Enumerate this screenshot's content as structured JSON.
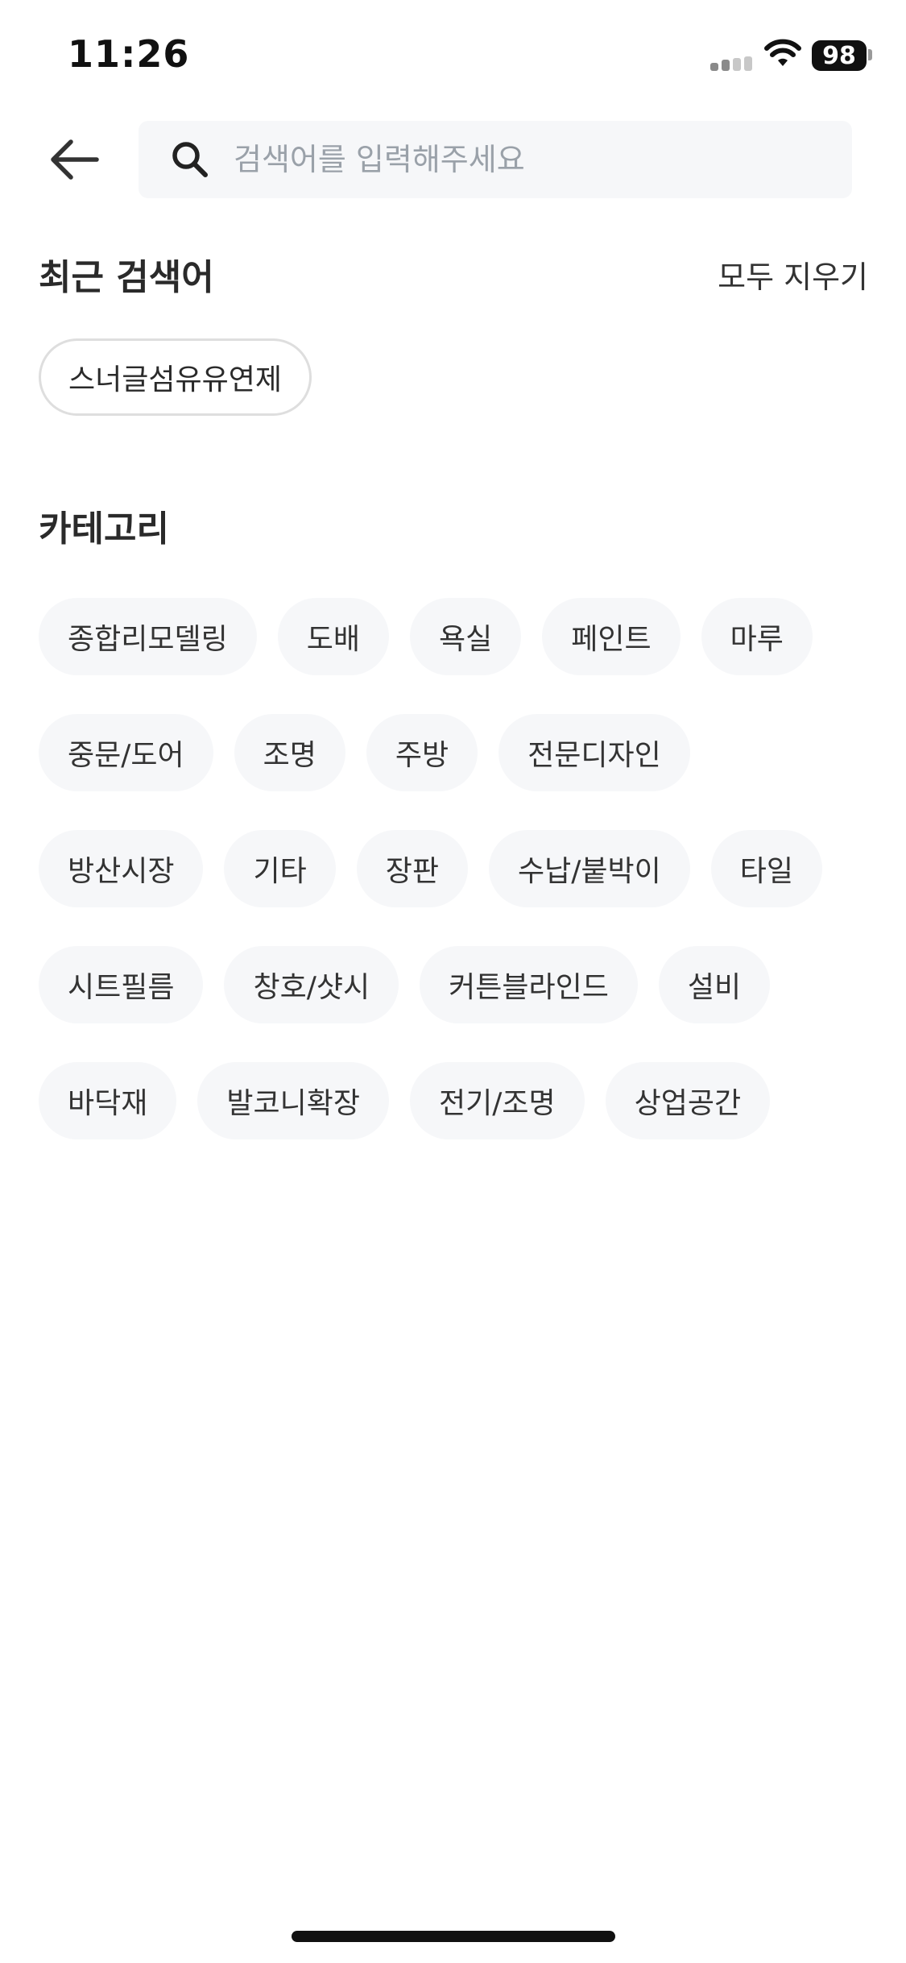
{
  "status_bar": {
    "time": "11:26",
    "battery": "98"
  },
  "search": {
    "placeholder": "검색어를 입력해주세요",
    "value": ""
  },
  "recent": {
    "title": "최근 검색어",
    "clear_all_label": "모두 지우기",
    "items": [
      "스너글섬유유연제"
    ]
  },
  "categories": {
    "title": "카테고리",
    "items": [
      "종합리모델링",
      "도배",
      "욕실",
      "페인트",
      "마루",
      "중문/도어",
      "조명",
      "주방",
      "전문디자인",
      "방산시장",
      "기타",
      "장판",
      "수납/붙박이",
      "타일",
      "시트필름",
      "창호/샷시",
      "커튼블라인드",
      "설비",
      "바닥재",
      "발코니확장",
      "전기/조명",
      "상업공간"
    ]
  },
  "icons": {
    "back": "arrow-left-icon",
    "search": "search-icon",
    "signal": "cellular-signal-icon",
    "wifi": "wifi-icon",
    "battery": "battery-icon"
  }
}
